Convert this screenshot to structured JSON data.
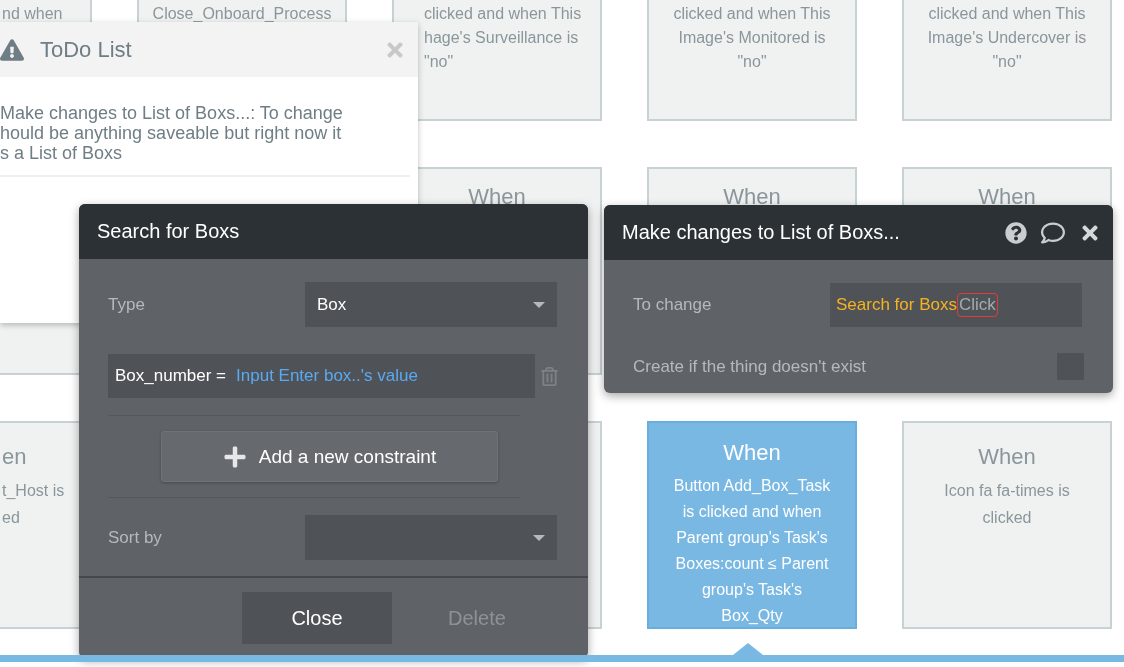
{
  "card_rows": [
    {
      "cards": [
        {
          "kind": "cut-left",
          "selected": false,
          "lines": [
            "nd when"
          ]
        },
        {
          "kind": "full",
          "selected": false,
          "lines": [
            "Close_Onboard_Process"
          ]
        },
        {
          "kind": "cut-under-panel",
          "selected": false,
          "lines": [
            "clicked and when This",
            "hage's Surveillance is",
            "\"no\""
          ]
        },
        {
          "kind": "full",
          "selected": false,
          "lines": [
            "clicked and when This",
            "Image's Monitored is",
            "\"no\""
          ]
        },
        {
          "kind": "full",
          "selected": false,
          "lines": [
            "clicked and when This",
            "Image's Undercover is",
            "\"no\""
          ]
        }
      ]
    },
    {
      "cards": [
        {
          "kind": "full",
          "selected": false
        },
        {
          "kind": "full",
          "selected": false,
          "title": "When"
        },
        {
          "kind": "full",
          "selected": false,
          "title": "When"
        },
        {
          "kind": "full",
          "selected": false,
          "title": "When"
        }
      ]
    },
    {
      "cards": [
        {
          "kind": "cut-left",
          "selected": false,
          "title": "en",
          "lines": [
            "t_Host is",
            "ed"
          ]
        },
        {
          "kind": "full",
          "selected": false
        },
        {
          "kind": "full",
          "selected": true,
          "title": "When",
          "lines": [
            "Button Add_Box_Task",
            "is clicked and when",
            "Parent group's Task's",
            "Boxes:count ≤ Parent",
            "group's Task's",
            "Box_Qty"
          ]
        },
        {
          "kind": "full",
          "selected": false,
          "title": "When",
          "lines": [
            "Icon fa fa-times is",
            "clicked"
          ]
        }
      ]
    }
  ],
  "todo_panel": {
    "title": "ToDo List",
    "lines": [
      "Make changes to List of Boxs...: To change",
      "hould be anything saveable but right now it",
      "s a List of Boxs"
    ]
  },
  "search_dialog": {
    "title": "Search for Boxs",
    "type": {
      "label": "Type",
      "value": "Box"
    },
    "constraint": {
      "field": "Box_number =",
      "value": "Input Enter box..'s value"
    },
    "add_button": "Add a new constraint",
    "sort": {
      "label": "Sort by"
    },
    "buttons": [
      {
        "label": "Close",
        "disabled": false
      },
      {
        "label": "Delete",
        "disabled": true
      }
    ]
  },
  "action_panel": {
    "title": "Make changes to List of Boxs...",
    "to_change": {
      "label": "To change",
      "value": "Search for Boxs",
      "hint": "Click"
    },
    "create_if_missing": {
      "label": "Create if the thing doesn't exist",
      "checked": false
    }
  }
}
